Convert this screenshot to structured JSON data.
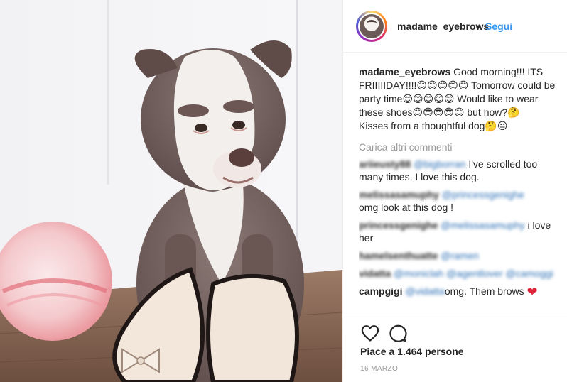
{
  "post": {
    "username": "madame_eyebrows",
    "separator": "•",
    "follow_label": "Segui"
  },
  "caption": {
    "username": "madame_eyebrows",
    "text": "Good morning!!! ITS FRIIIIIDAY!!!!😊😊😊😊😊 Tomorrow could be party time😊😊😊😊😊 Would like to wear these shoes😊😎😎😎😊 but how?🤔",
    "line2": "Kisses from a thoughtful dog🤔😐"
  },
  "load_more_label": "Carica altri commenti",
  "comments": [
    {
      "user": "ariieusty88",
      "tag": "@bigborran",
      "text": "I've scrolled too many times. I love this dog.",
      "blurred_user": true,
      "blurred_tag": true
    },
    {
      "user": "melissasamuphy",
      "tag": "@princessgenighe",
      "text": "omg look at this dog !",
      "blurred_user": true,
      "blurred_tag": true
    },
    {
      "user": "princessgenighe",
      "tag": "@melissasamuphy",
      "text": "i love her",
      "blurred_user": true,
      "blurred_tag": true
    },
    {
      "user": "hamelsenthuatte",
      "tag": "@ramen",
      "text": "",
      "blurred_user": true,
      "blurred_tag": true
    },
    {
      "user": "vidatta",
      "tag": "@moniclah @agentlover @camoggi",
      "text": "",
      "blurred_user": true,
      "blurred_tag": true
    },
    {
      "user": "campgigi",
      "tag": "@vidatta",
      "text": "omg. Them brows",
      "blurred_user": false,
      "blurred_tag": true
    }
  ],
  "likes_text": "Piace a 1.464 persone",
  "date_text": "16 MARZO",
  "icons": {
    "like": "heart-outline-icon",
    "comment": "speech-bubble-icon"
  },
  "colors": {
    "link": "#3897f0",
    "text": "#262626",
    "muted": "#999999",
    "heart": "#e0243a"
  }
}
